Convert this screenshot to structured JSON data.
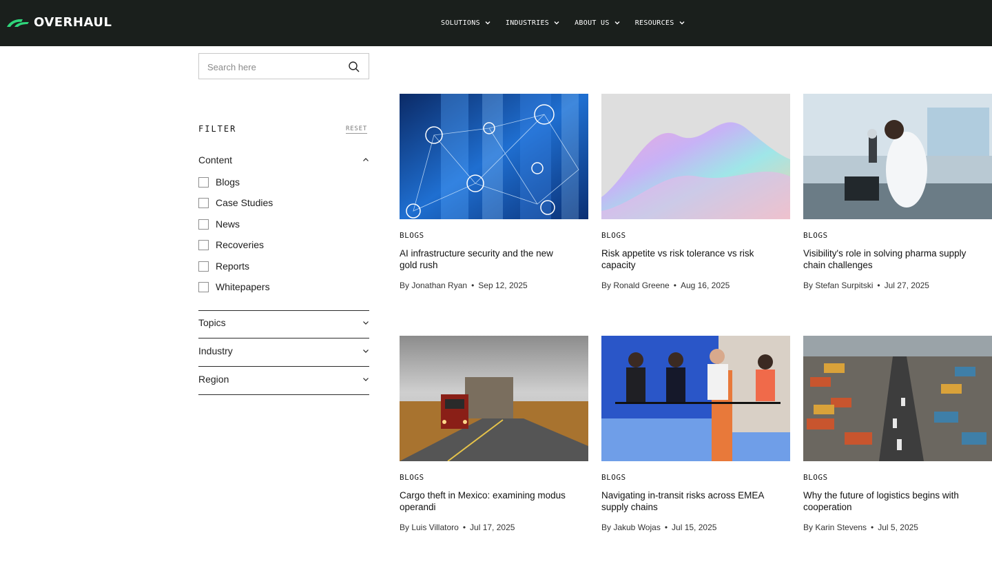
{
  "header": {
    "logo_text": "OVERHAUL",
    "nav": [
      {
        "label": "SOLUTIONS"
      },
      {
        "label": "INDUSTRIES"
      },
      {
        "label": "ABOUT US"
      },
      {
        "label": "RESOURCES"
      }
    ]
  },
  "search": {
    "placeholder": "Search here"
  },
  "filter": {
    "title": "FILTER",
    "reset_label": "RESET",
    "content_label": "Content",
    "options": [
      "Blogs",
      "Case Studies",
      "News",
      "Recoveries",
      "Reports",
      "Whitepapers"
    ],
    "topics_label": "Topics",
    "industry_label": "Industry",
    "region_label": "Region"
  },
  "cards": [
    {
      "category": "BLOGS",
      "title": "AI infrastructure security and the new gold rush",
      "author": "By Jonathan Ryan",
      "date": "Sep 12, 2025"
    },
    {
      "category": "BLOGS",
      "title": "Risk appetite vs risk tolerance vs risk capacity",
      "author": "By Ronald Greene",
      "date": "Aug 16, 2025"
    },
    {
      "category": "BLOGS",
      "title": "Visibility's role in solving pharma supply chain challenges",
      "author": "By Stefan Surpitski",
      "date": "Jul 27, 2025"
    },
    {
      "category": "BLOGS",
      "title": "Cargo theft in Mexico: examining modus operandi",
      "author": "By Luis Villatoro",
      "date": "Jul 17, 2025"
    },
    {
      "category": "BLOGS",
      "title": "Navigating in-transit risks across EMEA supply chains",
      "author": "By Jakub Wojas",
      "date": "Jul 15, 2025"
    },
    {
      "category": "BLOGS",
      "title": "Why the future of logistics begins with cooperation",
      "author": "By Karin Stevens",
      "date": "Jul 5, 2025"
    }
  ],
  "colors": {
    "header_bg": "#1a1f1c",
    "brand_green": "#2fd67b"
  }
}
